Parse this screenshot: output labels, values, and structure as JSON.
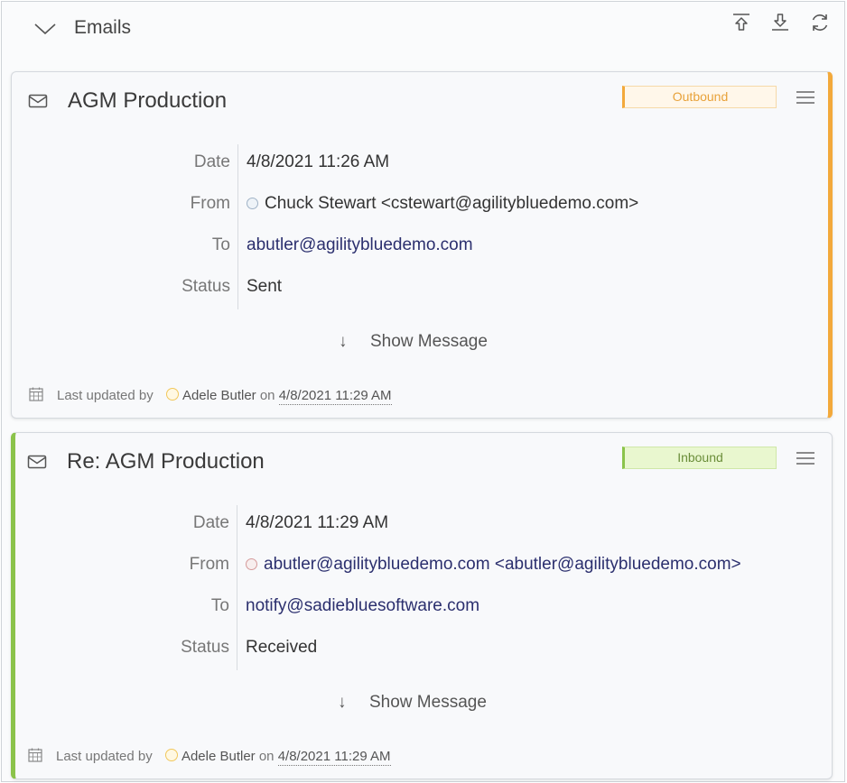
{
  "section": {
    "title": "Emails",
    "icons": {
      "collapse": "chevron-down-icon",
      "upload": "upload-icon",
      "download": "download-icon",
      "refresh": "refresh-icon"
    }
  },
  "labels": {
    "date": "Date",
    "from": "From",
    "to": "To",
    "status": "Status",
    "show_message": "Show Message",
    "last_updated_by": "Last updated by",
    "on": "on"
  },
  "emails": [
    {
      "subject": "AGM Production",
      "direction": "Outbound",
      "direction_color": "#f3a93b",
      "date": "4/8/2021 11:26 AM",
      "from": "Chuck Stewart <cstewart@agilitybluedemo.com>",
      "to": "abutler@agilitybluedemo.com",
      "status": "Sent",
      "updated_by": "Adele Butler",
      "updated_on": "4/8/2021 11:29 AM"
    },
    {
      "subject": "Re: AGM Production",
      "direction": "Inbound",
      "direction_color": "#8bc34a",
      "date": "4/8/2021 11:29 AM",
      "from": "abutler@agilitybluedemo.com <abutler@agilitybluedemo.com>",
      "to": "notify@sadiebluesoftware.com",
      "status": "Received",
      "updated_by": "Adele Butler",
      "updated_on": "4/8/2021 11:29 AM"
    }
  ]
}
